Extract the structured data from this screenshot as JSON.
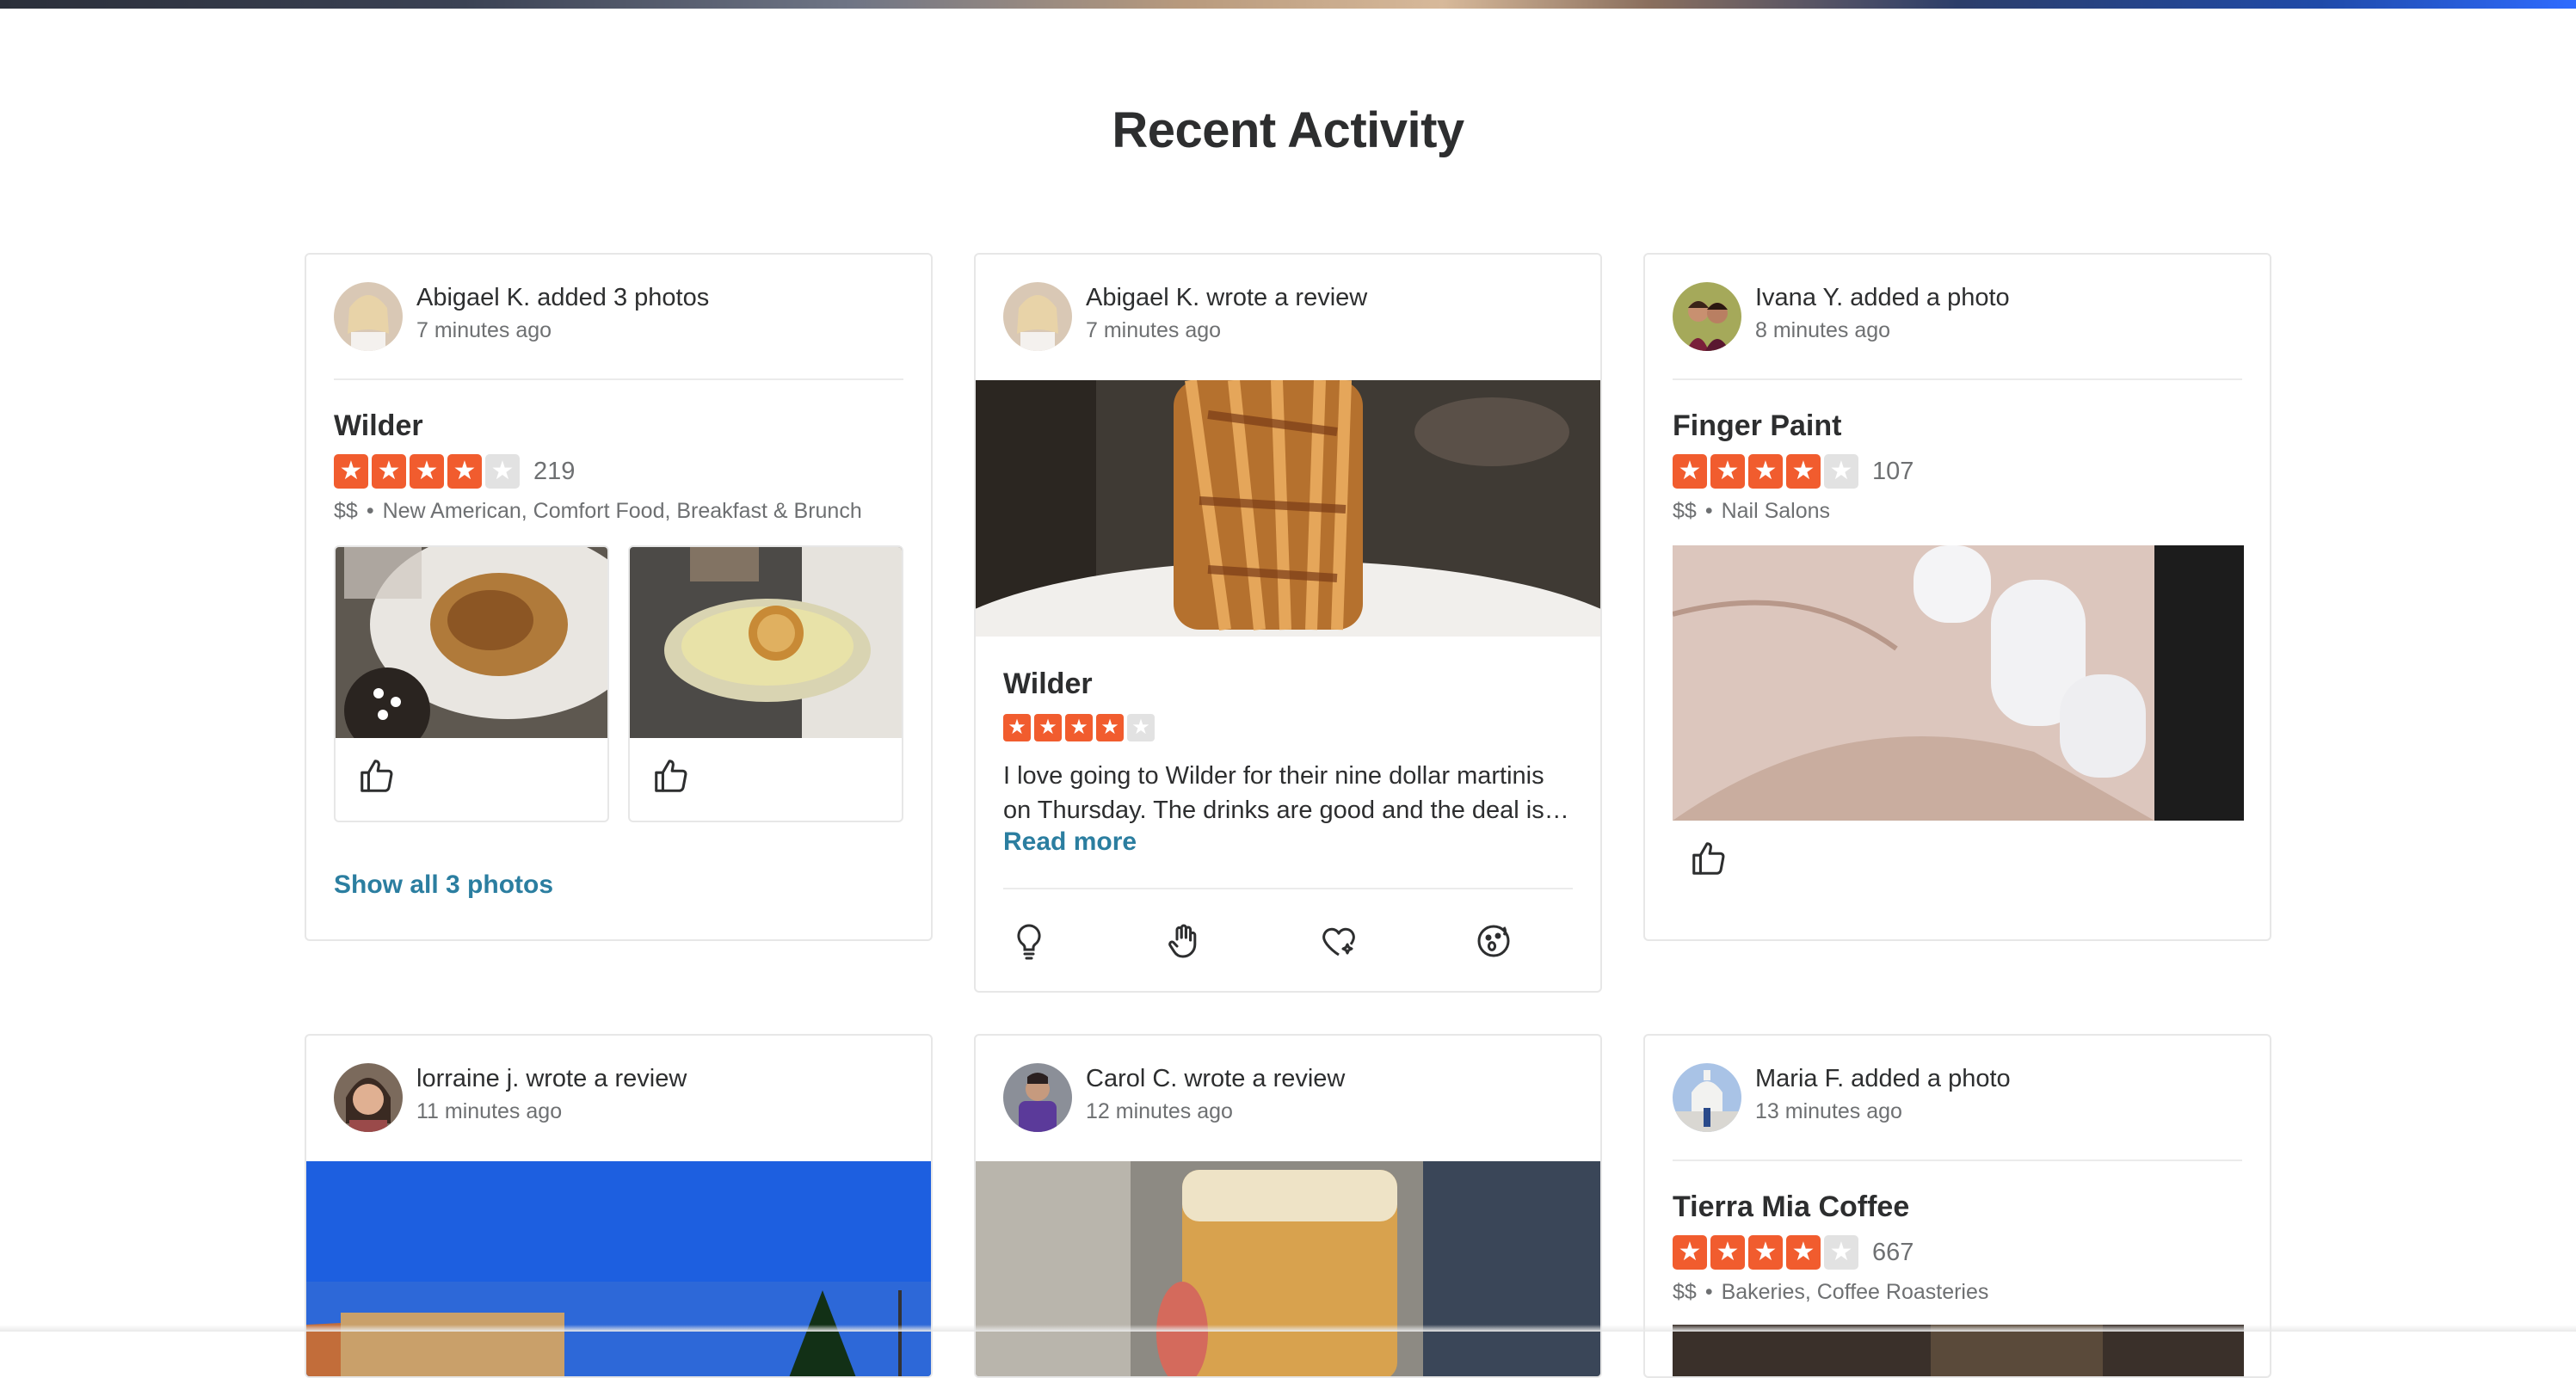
{
  "section": {
    "title": "Recent Activity"
  },
  "cards": [
    {
      "actor": "Abigael K. added 3 photos",
      "time": "7 minutes ago",
      "business": "Wilder",
      "rating": 4,
      "review_count": "219",
      "price": "$$",
      "categories": "New American, Comfort Food, Breakfast & Brunch",
      "show_all": "Show all 3 photos"
    },
    {
      "actor": "Abigael K. wrote a review",
      "time": "7 minutes ago",
      "business": "Wilder",
      "rating": 4,
      "review_line1": "I love going to Wilder for their nine dollar martinis",
      "review_line2": "on Thursday. The drinks are good and the deal is…",
      "read_more": "Read more"
    },
    {
      "actor": "Ivana Y. added a photo",
      "time": "8 minutes ago",
      "business": "Finger Paint",
      "rating": 4,
      "review_count": "107",
      "price": "$$",
      "categories": "Nail Salons"
    },
    {
      "actor": "lorraine j. wrote a review",
      "time": "11 minutes ago"
    },
    {
      "actor": "Carol C. wrote a review",
      "time": "12 minutes ago"
    },
    {
      "actor": "Maria F. added a photo",
      "time": "13 minutes ago",
      "business": "Tierra Mia Coffee",
      "rating": 4,
      "review_count": "667",
      "price": "$$",
      "categories": "Bakeries, Coffee Roasteries"
    }
  ],
  "colors": {
    "star": "#f15c2e",
    "star_off": "#e2e2e2",
    "link": "#2b7ea0"
  },
  "icons": [
    "thumbs-up-icon",
    "lightbulb-icon",
    "clapping-hand-icon",
    "heart-sparkle-icon",
    "surprised-face-icon",
    "star-icon"
  ]
}
